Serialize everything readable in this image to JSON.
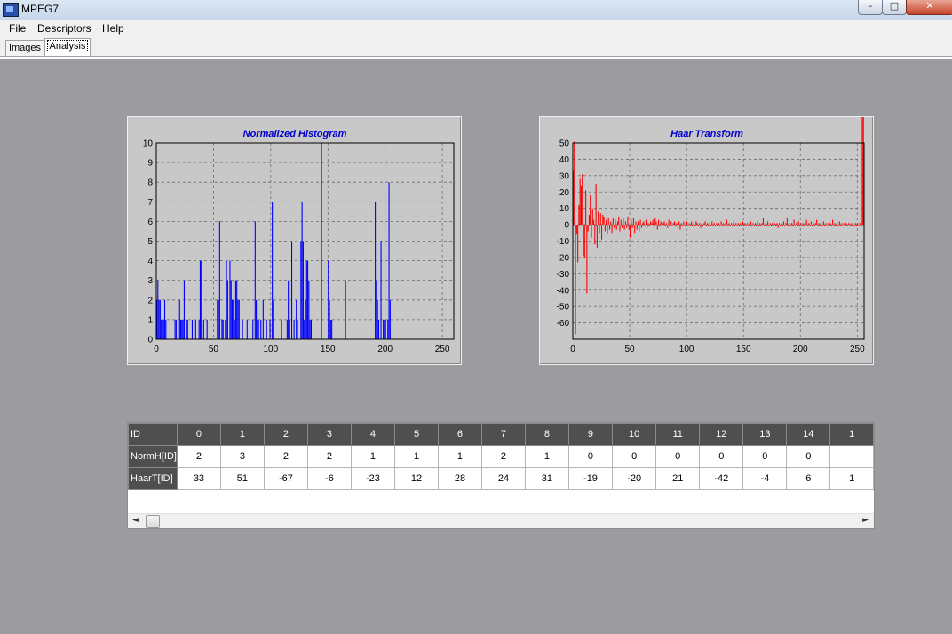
{
  "window": {
    "title": "MPEG7",
    "minimize": "–",
    "maximize": "□",
    "close": "✕"
  },
  "menu": [
    "File",
    "Descriptors",
    "Help"
  ],
  "tabs": [
    {
      "label": "Images",
      "active": false
    },
    {
      "label": "Analysis",
      "active": true
    }
  ],
  "colors": {
    "histogram": "#0000ff",
    "haar": "#ff0000",
    "title": "#0000cc",
    "plot_bg": "#c8c8c8"
  },
  "chart_data": [
    {
      "type": "bar",
      "title": "Normalized Histogram",
      "xlim": [
        0,
        260
      ],
      "ylim": [
        0,
        10
      ],
      "xticks": [
        0,
        50,
        100,
        150,
        200,
        250
      ],
      "yticks": [
        0,
        1,
        2,
        3,
        4,
        5,
        6,
        7,
        8,
        9,
        10
      ],
      "grid": true,
      "x": [
        0,
        1,
        2,
        3,
        4,
        5,
        6,
        7,
        8,
        9,
        10,
        11,
        12,
        13,
        14,
        15,
        16,
        17,
        18,
        19,
        20,
        21,
        22,
        23,
        24,
        25,
        26,
        27,
        28,
        29,
        30,
        31,
        32,
        33,
        34,
        35,
        36,
        37,
        38,
        39,
        40,
        41,
        42,
        43,
        44,
        45,
        46,
        47,
        48,
        49,
        50,
        51,
        52,
        53,
        54,
        55,
        56,
        57,
        58,
        59,
        60,
        61,
        62,
        63,
        64,
        65,
        66,
        67,
        68,
        69,
        70,
        71,
        72,
        73,
        74,
        75,
        76,
        77,
        78,
        79,
        80,
        81,
        82,
        83,
        84,
        85,
        86,
        87,
        88,
        89,
        90,
        91,
        92,
        93,
        94,
        95,
        96,
        97,
        98,
        99,
        100,
        101,
        102,
        103,
        104,
        105,
        106,
        107,
        108,
        109,
        110,
        111,
        112,
        113,
        114,
        115,
        116,
        117,
        118,
        119,
        120,
        121,
        122,
        123,
        124,
        125,
        126,
        127,
        128,
        129,
        130,
        131,
        132,
        133,
        134,
        135,
        136,
        137,
        138,
        139,
        140,
        141,
        142,
        143,
        144,
        145,
        146,
        147,
        148,
        149,
        150,
        151,
        152,
        153,
        154,
        155,
        156,
        157,
        158,
        159,
        160,
        161,
        162,
        163,
        164,
        165,
        166,
        167,
        168,
        169,
        170,
        171,
        172,
        173,
        174,
        175,
        176,
        177,
        178,
        179,
        180,
        181,
        182,
        183,
        184,
        185,
        186,
        187,
        188,
        189,
        190,
        191,
        192,
        193,
        194,
        195,
        196,
        197,
        198,
        199,
        200,
        201,
        202,
        203,
        204,
        205,
        206,
        207,
        208,
        209,
        210
      ],
      "values": [
        2,
        3,
        2,
        2,
        1,
        1,
        1,
        2,
        1,
        0,
        0,
        0,
        0,
        0,
        0,
        0,
        1,
        1,
        0,
        0,
        2,
        1,
        1,
        1,
        3,
        0,
        1,
        1,
        0,
        0,
        0,
        1,
        0,
        0,
        1,
        0,
        0,
        1,
        4,
        4,
        0,
        1,
        0,
        0,
        1,
        0,
        0,
        0,
        0,
        0,
        0,
        0,
        0,
        2,
        2,
        6,
        0,
        1,
        1,
        0,
        1,
        4,
        3,
        0,
        4,
        3,
        2,
        2,
        1,
        3,
        3,
        2,
        2,
        0,
        0,
        1,
        0,
        0,
        0,
        1,
        0,
        0,
        0,
        0,
        1,
        0,
        6,
        2,
        1,
        1,
        0,
        1,
        0,
        2,
        0,
        0,
        1,
        0,
        0,
        1,
        0,
        7,
        2,
        0,
        0,
        0,
        0,
        0,
        0,
        1,
        0,
        0,
        0,
        0,
        1,
        3,
        1,
        0,
        5,
        0,
        1,
        0,
        2,
        1,
        0,
        0,
        5,
        7,
        5,
        1,
        2,
        4,
        4,
        3,
        1,
        1,
        0,
        0,
        0,
        0,
        0,
        0,
        0,
        0,
        10,
        0,
        0,
        0,
        0,
        0,
        4,
        2,
        1,
        1,
        0,
        0,
        0,
        0,
        0,
        0,
        0,
        0,
        0,
        0,
        0,
        3,
        0,
        0,
        0,
        0,
        0,
        0,
        0,
        0,
        0,
        0,
        0,
        0,
        0,
        0,
        0,
        0,
        0,
        0,
        0,
        0,
        0,
        0,
        0,
        0,
        0,
        7,
        3,
        2,
        1,
        0,
        5,
        0,
        1,
        1,
        1,
        0,
        1,
        8,
        2,
        0,
        0,
        0,
        0,
        0,
        0
      ]
    },
    {
      "type": "bar",
      "title": "Haar Transform",
      "xlim": [
        0,
        256
      ],
      "ylim": [
        -70,
        50
      ],
      "xticks": [
        0,
        50,
        100,
        150,
        200,
        250
      ],
      "yticks": [
        50,
        40,
        30,
        20,
        10,
        0,
        -10,
        -20,
        -30,
        -40,
        -50,
        -60
      ],
      "grid": true,
      "x": [
        0,
        1,
        2,
        3,
        4,
        5,
        6,
        7,
        8,
        9,
        10,
        11,
        12,
        13,
        14,
        15,
        16,
        17,
        18,
        19,
        20,
        21,
        22,
        23,
        24,
        25,
        26,
        27,
        28,
        29,
        30,
        31,
        32,
        33,
        34,
        35,
        36,
        37,
        38,
        39,
        40,
        41,
        42,
        43,
        44,
        45,
        46,
        47,
        48,
        49,
        50,
        51,
        52,
        53,
        54,
        55,
        56,
        57,
        58,
        59,
        60,
        61,
        62,
        63,
        64,
        65,
        66,
        67,
        68,
        69,
        70,
        71,
        72,
        73,
        74,
        75,
        76,
        77,
        78,
        79,
        80,
        81,
        82,
        83,
        84,
        85,
        86,
        87,
        88,
        89,
        90,
        91,
        92,
        93,
        94,
        95,
        96,
        97,
        98,
        99,
        100,
        101,
        102,
        103,
        104,
        105,
        106,
        107,
        108,
        109,
        110,
        111,
        112,
        113,
        114,
        115,
        116,
        117,
        118,
        119,
        120,
        121,
        122,
        123,
        124,
        125,
        126,
        127,
        128,
        129,
        130,
        131,
        132,
        133,
        134,
        135,
        136,
        137,
        138,
        139,
        140,
        141,
        142,
        143,
        144,
        145,
        146,
        147,
        148,
        149,
        150,
        151,
        152,
        153,
        154,
        155,
        156,
        157,
        158,
        159,
        160,
        161,
        162,
        163,
        164,
        165,
        166,
        167,
        168,
        169,
        170,
        171,
        172,
        173,
        174,
        175,
        176,
        177,
        178,
        179,
        180,
        181,
        182,
        183,
        184,
        185,
        186,
        187,
        188,
        189,
        190,
        191,
        192,
        193,
        194,
        195,
        196,
        197,
        198,
        199,
        200,
        201,
        202,
        203,
        204,
        205,
        206,
        207,
        208,
        209,
        210,
        211,
        212,
        213,
        214,
        215,
        216,
        217,
        218,
        219,
        220,
        221,
        222,
        223,
        224,
        225,
        226,
        227,
        228,
        229,
        230,
        231,
        232,
        233,
        234,
        235,
        236,
        237,
        238,
        239,
        240,
        241,
        242,
        243,
        244,
        245,
        246,
        247,
        248,
        249,
        250,
        251,
        252,
        253,
        254,
        255
      ],
      "values": [
        33,
        51,
        -67,
        -6,
        -23,
        12,
        28,
        24,
        31,
        -19,
        -20,
        21,
        -42,
        -4,
        6,
        18,
        -8,
        10,
        3,
        -12,
        25,
        -14,
        8,
        -5,
        7,
        -9,
        6,
        5,
        -4,
        3,
        -6,
        4,
        -3,
        2,
        -5,
        4,
        -2,
        3,
        -3,
        2,
        5,
        -4,
        3,
        -2,
        4,
        -3,
        2,
        -2,
        5,
        -3,
        -8,
        3,
        -2,
        4,
        -5,
        2,
        -3,
        2,
        -4,
        3,
        -2,
        1,
        2,
        -1,
        3,
        -2,
        1,
        -1,
        2,
        1,
        3,
        -2,
        4,
        2,
        -3,
        3,
        -1,
        2,
        -2,
        1,
        2,
        -1,
        1,
        -2,
        3,
        -1,
        2,
        -1,
        1,
        2,
        -1,
        1,
        -2,
        2,
        -3,
        1,
        -1,
        2,
        -1,
        1,
        2,
        -1,
        1,
        -1,
        2,
        -1,
        1,
        -1,
        2,
        1,
        -1,
        1,
        -2,
        1,
        -1,
        1,
        2,
        -1,
        1,
        -1,
        1,
        -1,
        2,
        -1,
        1,
        -1,
        1,
        -1,
        1,
        -1,
        2,
        -1,
        1,
        -1,
        1,
        3,
        -1,
        1,
        -1,
        1,
        -1,
        2,
        -1,
        1,
        -1,
        1,
        -1,
        1,
        -1,
        2,
        -1,
        1,
        -1,
        1,
        -1,
        1,
        2,
        -1,
        1,
        -1,
        1,
        -1,
        2,
        -1,
        1,
        -1,
        1,
        4,
        -1,
        1,
        -1,
        2,
        -1,
        1,
        -1,
        1,
        -1,
        1,
        -1,
        1,
        -2,
        1,
        -1,
        1,
        -1,
        2,
        -1,
        1,
        4,
        -1,
        1,
        -1,
        1,
        -1,
        3,
        -1,
        1,
        -1,
        2,
        -1,
        1,
        -1,
        1,
        -1,
        1,
        3,
        -1,
        1,
        -1,
        2,
        -1,
        1,
        -1,
        1,
        3,
        -1,
        1,
        -1,
        1,
        -1,
        2,
        -1,
        1,
        -1,
        1,
        -1,
        1,
        -1,
        3,
        -1,
        1,
        -1,
        1,
        -1,
        2,
        -1,
        1,
        -1,
        1,
        -1,
        1,
        -1,
        1,
        -1,
        1,
        -1,
        1,
        -1,
        1,
        -1,
        1,
        -1,
        1,
        -1
      ]
    }
  ],
  "grid": {
    "header_label": "ID",
    "ids": [
      "0",
      "1",
      "2",
      "3",
      "4",
      "5",
      "6",
      "7",
      "8",
      "9",
      "10",
      "11",
      "12",
      "13",
      "14",
      "1"
    ],
    "rows": [
      {
        "label": "NormH[ID]",
        "values": [
          "2",
          "3",
          "2",
          "2",
          "1",
          "1",
          "1",
          "2",
          "1",
          "0",
          "0",
          "0",
          "0",
          "0",
          "0",
          ""
        ]
      },
      {
        "label": "HaarT[ID]",
        "values": [
          "33",
          "51",
          "-67",
          "-6",
          "-23",
          "12",
          "28",
          "24",
          "31",
          "-19",
          "-20",
          "21",
          "-42",
          "-4",
          "6",
          "1"
        ]
      }
    ],
    "scroll_left": "◄",
    "scroll_right": "►"
  }
}
